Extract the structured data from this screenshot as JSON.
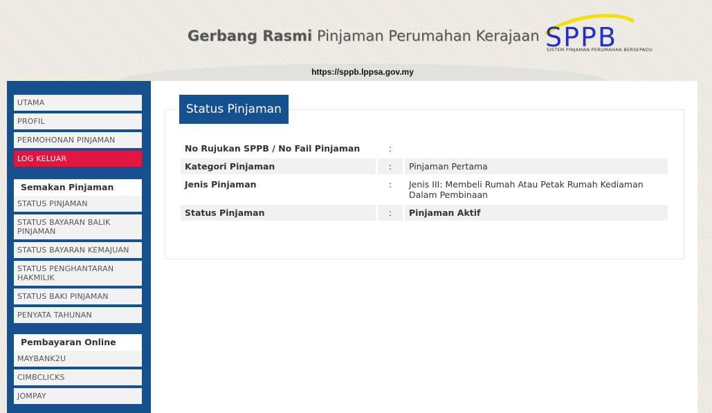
{
  "header": {
    "title_bold": "Gerbang Rasmi",
    "title_rest": " Pinjaman Perumahan Kerajaan",
    "logo_text": "SPPB",
    "logo_subtitle": "SISTEM PINJAMAN PERUMAHAN BERSEPADU",
    "url": "https://sppb.lppsa.gov.my",
    "colors": {
      "logo_blue": "#2230c4",
      "swoosh": "#f2e000"
    }
  },
  "sidebar": {
    "color": "#16508f",
    "main_menu": [
      {
        "label": "UTAMA"
      },
      {
        "label": "PROFIL"
      },
      {
        "label": "PERMOHONAN PINJAMAN"
      },
      {
        "label": "LOG KELUAR",
        "active": true,
        "color": "#e0163e"
      }
    ],
    "semakan": {
      "heading": "Semakan Pinjaman",
      "items": [
        {
          "label": "STATUS PINJAMAN"
        },
        {
          "label": "STATUS BAYARAN BALIK PINJAMAN"
        },
        {
          "label": "STATUS BAYARAN KEMAJUAN"
        },
        {
          "label": "STATUS PENGHANTARAN HAKMILIK"
        },
        {
          "label": "STATUS BAKI PINJAMAN"
        },
        {
          "label": "PENYATA TAHUNAN"
        }
      ]
    },
    "pembayaran": {
      "heading": "Pembayaran Online",
      "items": [
        {
          "label": "MAYBANK2U"
        },
        {
          "label": "CIMBCLICKS"
        },
        {
          "label": "JOMPAY"
        }
      ]
    }
  },
  "main": {
    "panel_title": "Status Pinjaman",
    "rows": [
      {
        "label": "No Rujukan SPPB / No Fail Pinjaman",
        "sep": ":",
        "value": ""
      },
      {
        "label": "Kategori Pinjaman",
        "sep": ":",
        "value": "Pinjaman Pertama"
      },
      {
        "label": "Jenis Pinjaman",
        "sep": ":",
        "value": "Jenis III: Membeli Rumah Atau Petak Rumah Kediaman Dalam Pembinaan"
      },
      {
        "label": "Status Pinjaman",
        "sep": ":",
        "value": "Pinjaman Aktif"
      }
    ]
  }
}
